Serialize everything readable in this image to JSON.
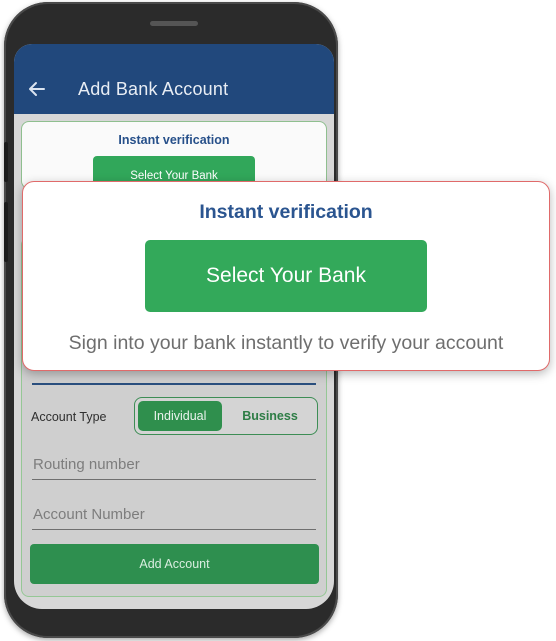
{
  "appbar": {
    "title": "Add Bank Account",
    "back_icon": "arrow-left-icon"
  },
  "inline_instant": {
    "title": "Instant verification",
    "button_label": "Select Your Bank"
  },
  "form": {
    "account_type_label": "Account Type",
    "account_type_options": [
      "Individual",
      "Business"
    ],
    "account_type_selected": "Individual",
    "routing_placeholder": "Routing number",
    "account_placeholder": "Account Number",
    "submit_label": "Add Account"
  },
  "popup": {
    "title": "Instant verification",
    "button_label": "Select Your Bank",
    "description": "Sign into your bank instantly to verify your account"
  },
  "colors": {
    "appbar": "#21487c",
    "primary_green": "#33a95a",
    "heading_blue": "#2b5590",
    "popup_border": "#e06a6a"
  }
}
